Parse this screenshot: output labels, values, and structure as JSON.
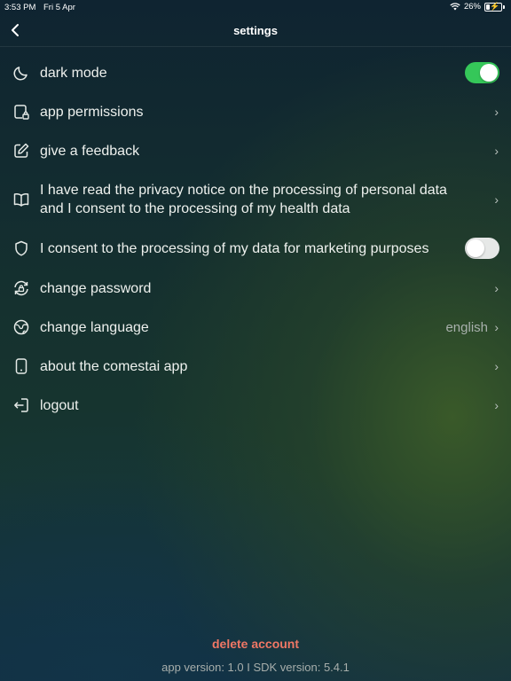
{
  "status_bar": {
    "time": "3:53 PM",
    "date": "Fri 5 Apr",
    "battery": "26%",
    "battery_level": 0.26
  },
  "nav": {
    "title": "settings"
  },
  "settings": {
    "dark_mode": {
      "label": "dark mode",
      "toggle": "on"
    },
    "app_permissions": {
      "label": "app permissions"
    },
    "feedback": {
      "label": "give a feedback"
    },
    "privacy": {
      "label": "I have read the privacy notice on the processing of personal data and I consent to the processing of my health data"
    },
    "marketing": {
      "label": "I consent to the processing of my data for marketing purposes",
      "toggle": "off"
    },
    "change_password": {
      "label": "change password"
    },
    "change_language": {
      "label": "change language",
      "value": "english"
    },
    "about": {
      "label": "about the comestai app"
    },
    "logout": {
      "label": "logout"
    }
  },
  "footer": {
    "delete_account": "delete account",
    "version": "app version: 1.0 I SDK version: 5.4.1"
  },
  "colors": {
    "toggle_on": "#35c759",
    "delete": "#f07765"
  }
}
